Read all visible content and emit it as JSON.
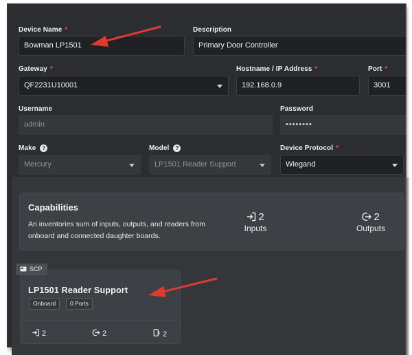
{
  "form": {
    "device_name": {
      "label": "Device Name",
      "required": "*",
      "value": "Bowman LP1501"
    },
    "description": {
      "label": "Description",
      "value": "Primary Door Controller"
    },
    "gateway": {
      "label": "Gateway",
      "required": "*",
      "value": "QF2231U10001"
    },
    "hostname": {
      "label": "Hostname / IP Address",
      "required": "*",
      "value": "192.168.0.9"
    },
    "port": {
      "label": "Port",
      "required": "*",
      "value": "3001"
    },
    "username": {
      "label": "Username",
      "value": "admin"
    },
    "password": {
      "label": "Password",
      "value": "••••••••"
    },
    "make": {
      "label": "Make",
      "help": "?",
      "value": "Mercury"
    },
    "model": {
      "label": "Model",
      "help": "?",
      "value": "LP1501 Reader Support"
    },
    "device_protocol": {
      "label": "Device Protocol",
      "required": "*",
      "value": "Wiegand"
    }
  },
  "capabilities": {
    "title": "Capabilities",
    "description": "An inventories sum of inputs, outputs, and readers from onboard and connected daughter boards.",
    "inputs": {
      "count": "2",
      "label": "Inputs",
      "icon": "input-arrow-icon"
    },
    "outputs": {
      "count": "2",
      "label": "Outputs",
      "icon": "output-arrow-icon"
    }
  },
  "board": {
    "tag": "SCP",
    "title": "LP1501 Reader Support",
    "chips": [
      "Onboard",
      "0 Ports"
    ],
    "inputs": "2",
    "outputs": "2",
    "readers": "2"
  },
  "colors": {
    "background": "#2b2d31",
    "field": "#1f2124",
    "required": "#e0534f",
    "annotation_arrow": "#e03a2f"
  }
}
